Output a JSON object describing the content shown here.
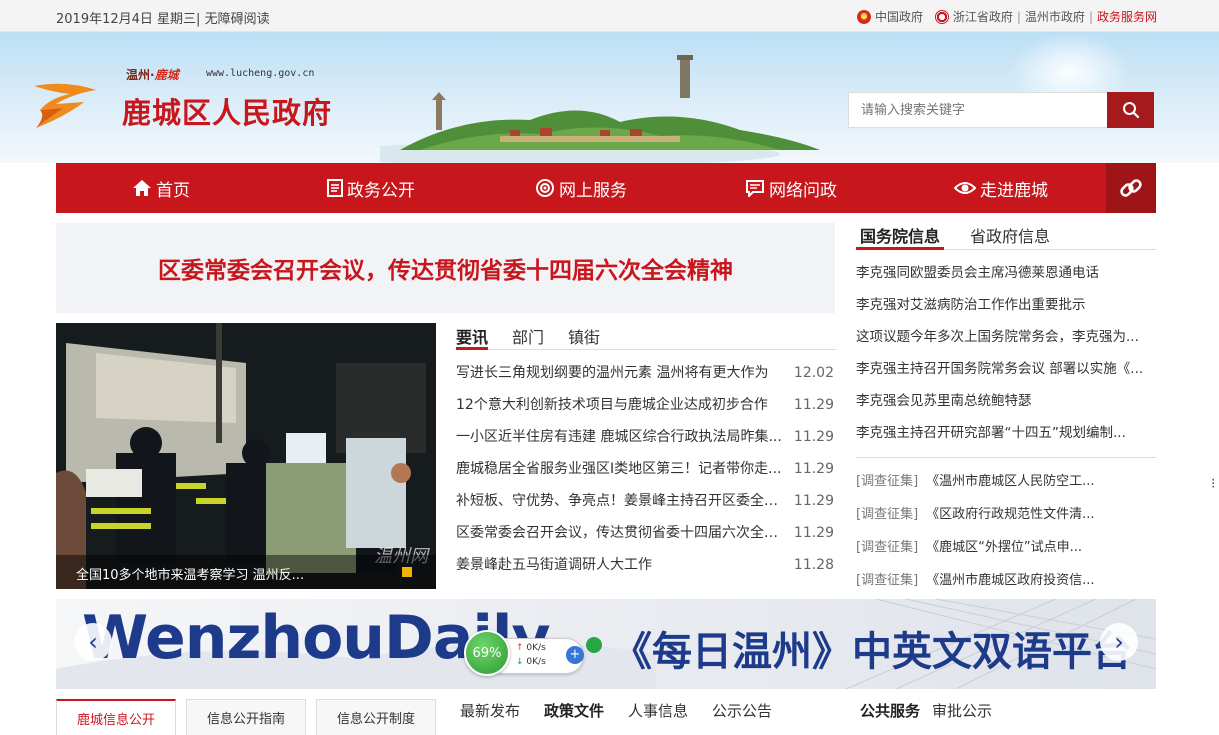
{
  "topbar": {
    "date": "2019年12月4日  星期三",
    "accessible": "无障碍阅读",
    "links": [
      "中国政府",
      "浙江省政府",
      "温州市政府",
      "政务服务网"
    ]
  },
  "header": {
    "small_brand_a": "温州·",
    "small_brand_b": "鹿城",
    "url": "www.lucheng.gov.cn",
    "title": "鹿城区人民政府",
    "search_placeholder": "请输入搜索关键字"
  },
  "nav": {
    "items": [
      "首页",
      "政务公开",
      "网上服务",
      "网络问政",
      "走进鹿城"
    ]
  },
  "headline": "区委常委会召开会议，传达贯彻省委十四届六次全会精神",
  "photo": {
    "caption": "全国10多个地市来温考察学习 温州反...",
    "watermark": "温州网"
  },
  "news": {
    "tabs": [
      "要讯",
      "部门",
      "镇街"
    ],
    "items": [
      {
        "title": "写进长三角规划纲要的温州元素 温州将有更大作为",
        "date": "12.02"
      },
      {
        "title": "12个意大利创新技术项目与鹿城企业达成初步合作",
        "date": "11.29"
      },
      {
        "title": "一小区近半住房有违建 鹿城区综合行政执法局昨集...",
        "date": "11.29"
      },
      {
        "title": "鹿城稳居全省服务业强区Ⅰ类地区第三！记者带你走...",
        "date": "11.29"
      },
      {
        "title": "补短板、守优势、争亮点！姜景峰主持召开区委全面...",
        "date": "11.29"
      },
      {
        "title": "区委常委会召开会议，传达贯彻省委十四届六次全会...",
        "date": "11.29"
      },
      {
        "title": "姜景峰赴五马街道调研人大工作",
        "date": "11.28"
      }
    ]
  },
  "right": {
    "tabs": [
      "国务院信息",
      "省政府信息"
    ],
    "items": [
      "李克强同欧盟委员会主席冯德莱恩通电话",
      "李克强对艾滋病防治工作作出重要批示",
      "这项议题今年多次上国务院常务会，李克强为...",
      "李克强主持召开国务院常务会议 部署以实施《...",
      "李克强会见苏里南总统鲍特瑟",
      "李克强主持召开研究部署“十四五”规划编制..."
    ],
    "survey_tag": "[调查征集]",
    "survey": [
      "《温州市鹿城区人民防空工...",
      "《区政府行政规范性文件清...",
      "《鹿城区“外摆位”试点申...",
      "《温州市鹿城区政府投资信..."
    ]
  },
  "banner": {
    "en": "WenzhouDaily",
    "cn": "《每日温州》中英文双语平台"
  },
  "speed": {
    "percent": "69%",
    "up": "0K/s",
    "down": "0K/s"
  },
  "bottom": {
    "left_tabs": [
      "鹿城信息公开",
      "信息公开指南",
      "信息公开制度"
    ],
    "mid_tabs": [
      "最新发布",
      "政策文件",
      "人事信息",
      "公示公告"
    ],
    "right_tabs": [
      "公共服务",
      "审批公示"
    ]
  },
  "colors": {
    "brand_red": "#c8161d",
    "banner_blue": "#1d3b8a"
  }
}
